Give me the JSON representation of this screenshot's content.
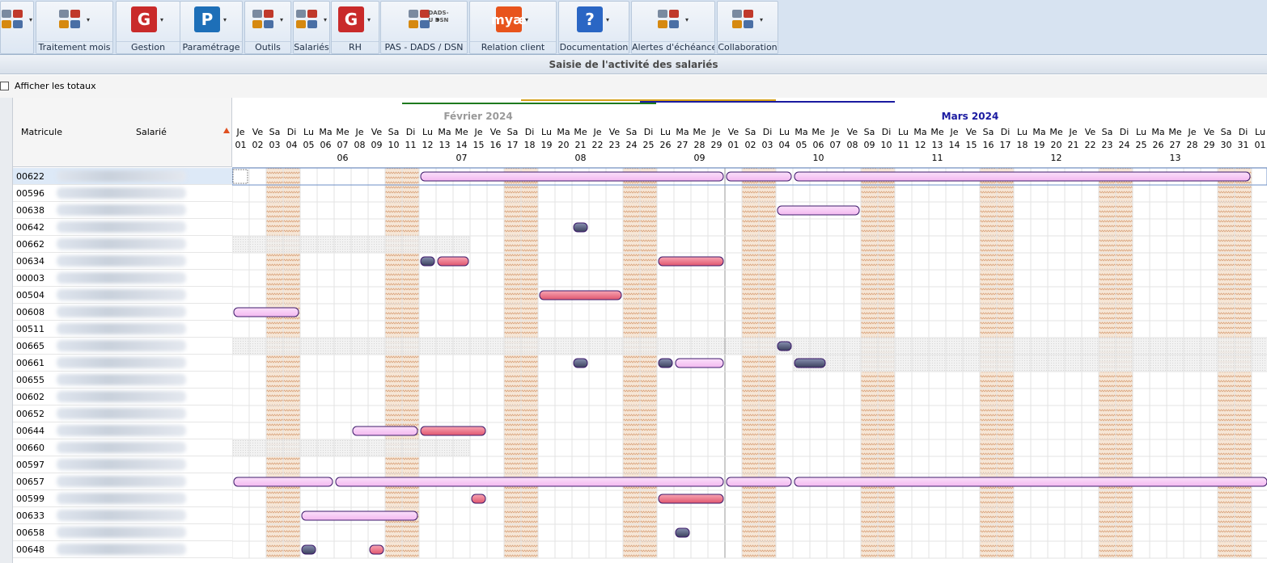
{
  "ribbon": {
    "groups": [
      {
        "id": "quick",
        "label": "",
        "icon": "quick-access-icons"
      },
      {
        "id": "traitement",
        "label": "Traitement mois",
        "icon": "monthly-processing-icons"
      },
      {
        "id": "gestion",
        "label": "Gestion",
        "icon": "gestion-g-icon",
        "glyph": "G"
      },
      {
        "id": "parametrage",
        "label": "Paramétrage",
        "icon": "parametrage-p-icon",
        "glyph": "P"
      },
      {
        "id": "outils",
        "label": "Outils",
        "icon": "tools-icon"
      },
      {
        "id": "salaries",
        "label": "Salariés",
        "icon": "employees-icon"
      },
      {
        "id": "rh",
        "label": "RH",
        "icon": "hr-icon",
        "glyph": "G"
      },
      {
        "id": "pas",
        "label": "PAS - DADS / DSN",
        "icon": "bank-building-icon",
        "sub": "DADS-U DSN"
      },
      {
        "id": "relation",
        "label": "Relation client",
        "icon": "customer-relation-icon",
        "glyph": "æ",
        "glyph_prefix": "my"
      },
      {
        "id": "documentation",
        "label": "Documentation",
        "icon": "help-book-icon",
        "glyph": "?"
      },
      {
        "id": "alertes",
        "label": "Alertes d'échéance",
        "icon": "stopwatch-icon"
      },
      {
        "id": "collaboration",
        "label": "Collaboration",
        "icon": "collaboration-icon"
      }
    ]
  },
  "page_title": "Saisie de l'activité des salariés",
  "options": {
    "show_totals_label": "Afficher les totaux",
    "show_totals_checked": false
  },
  "columns": {
    "matricule": "Matricule",
    "salarie": "Salarié"
  },
  "months": [
    {
      "label": "Février 2024",
      "color": "#9a9a9a"
    },
    {
      "label": "Mars 2024",
      "color": "#1a1aa0"
    }
  ],
  "days": [
    [
      "Je",
      "01"
    ],
    [
      "Ve",
      "02"
    ],
    [
      "Sa",
      "03"
    ],
    [
      "Di",
      "04"
    ],
    [
      "Lu",
      "05"
    ],
    [
      "Ma",
      "06"
    ],
    [
      "Me",
      "07"
    ],
    [
      "Je",
      "08"
    ],
    [
      "Ve",
      "09"
    ],
    [
      "Sa",
      "10"
    ],
    [
      "Di",
      "11"
    ],
    [
      "Lu",
      "12"
    ],
    [
      "Ma",
      "13"
    ],
    [
      "Me",
      "14"
    ],
    [
      "Je",
      "15"
    ],
    [
      "Ve",
      "16"
    ],
    [
      "Sa",
      "17"
    ],
    [
      "Di",
      "18"
    ],
    [
      "Lu",
      "19"
    ],
    [
      "Ma",
      "20"
    ],
    [
      "Me",
      "21"
    ],
    [
      "Je",
      "22"
    ],
    [
      "Ve",
      "23"
    ],
    [
      "Sa",
      "24"
    ],
    [
      "Di",
      "25"
    ],
    [
      "Lu",
      "26"
    ],
    [
      "Ma",
      "27"
    ],
    [
      "Me",
      "28"
    ],
    [
      "Je",
      "29"
    ],
    [
      "Ve",
      "01"
    ],
    [
      "Sa",
      "02"
    ],
    [
      "Di",
      "03"
    ],
    [
      "Lu",
      "04"
    ],
    [
      "Ma",
      "05"
    ],
    [
      "Me",
      "06"
    ],
    [
      "Je",
      "07"
    ],
    [
      "Ve",
      "08"
    ],
    [
      "Sa",
      "09"
    ],
    [
      "Di",
      "10"
    ],
    [
      "Lu",
      "11"
    ],
    [
      "Ma",
      "12"
    ],
    [
      "Me",
      "13"
    ],
    [
      "Je",
      "14"
    ],
    [
      "Ve",
      "15"
    ],
    [
      "Sa",
      "16"
    ],
    [
      "Di",
      "17"
    ],
    [
      "Lu",
      "18"
    ],
    [
      "Ma",
      "19"
    ],
    [
      "Me",
      "20"
    ],
    [
      "Je",
      "21"
    ],
    [
      "Ve",
      "22"
    ],
    [
      "Sa",
      "23"
    ],
    [
      "Di",
      "24"
    ],
    [
      "Lu",
      "25"
    ],
    [
      "Ma",
      "26"
    ],
    [
      "Me",
      "27"
    ],
    [
      "Je",
      "28"
    ],
    [
      "Ve",
      "29"
    ],
    [
      "Sa",
      "30"
    ],
    [
      "Di",
      "31"
    ],
    [
      "Lu",
      "01"
    ]
  ],
  "weeks": [
    {
      "label": "06",
      "start": 4
    },
    {
      "label": "07",
      "start": 11
    },
    {
      "label": "08",
      "start": 18
    },
    {
      "label": "09",
      "start": 25
    },
    {
      "label": "10",
      "start": 32
    },
    {
      "label": "11",
      "start": 39
    },
    {
      "label": "12",
      "start": 46
    },
    {
      "label": "13",
      "start": 53
    }
  ],
  "employees": [
    {
      "matricule": "00622",
      "selected": true
    },
    {
      "matricule": "00596"
    },
    {
      "matricule": "00638"
    },
    {
      "matricule": "00642"
    },
    {
      "matricule": "00662",
      "inactive": [
        0,
        13
      ]
    },
    {
      "matricule": "00634"
    },
    {
      "matricule": "00003"
    },
    {
      "matricule": "00504"
    },
    {
      "matricule": "00608"
    },
    {
      "matricule": "00511"
    },
    {
      "matricule": "00665",
      "inactive": [
        0,
        60
      ]
    },
    {
      "matricule": "00661",
      "inactive": [
        33,
        60
      ]
    },
    {
      "matricule": "00655"
    },
    {
      "matricule": "00602"
    },
    {
      "matricule": "00652"
    },
    {
      "matricule": "00644"
    },
    {
      "matricule": "00660",
      "inactive": [
        0,
        13
      ]
    },
    {
      "matricule": "00597"
    },
    {
      "matricule": "00657"
    },
    {
      "matricule": "00599"
    },
    {
      "matricule": "00633"
    },
    {
      "matricule": "00658"
    },
    {
      "matricule": "00648"
    }
  ],
  "activities": [
    {
      "row": 0,
      "start": 11,
      "end": 28,
      "type": "pink"
    },
    {
      "row": 0,
      "start": 29,
      "end": 32,
      "type": "pink"
    },
    {
      "row": 0,
      "start": 33,
      "end": 59,
      "type": "pink"
    },
    {
      "row": 2,
      "start": 32,
      "end": 36,
      "type": "pink"
    },
    {
      "row": 3,
      "start": 20,
      "end": 20,
      "type": "navy"
    },
    {
      "row": 5,
      "start": 11,
      "end": 11,
      "type": "navy"
    },
    {
      "row": 5,
      "start": 12,
      "end": 13,
      "type": "red"
    },
    {
      "row": 5,
      "start": 25,
      "end": 28,
      "type": "red"
    },
    {
      "row": 7,
      "start": 18,
      "end": 22,
      "type": "red"
    },
    {
      "row": 8,
      "start": 0,
      "end": 3,
      "type": "pink"
    },
    {
      "row": 10,
      "start": 32,
      "end": 32,
      "type": "navy"
    },
    {
      "row": 11,
      "start": 20,
      "end": 20,
      "type": "navy"
    },
    {
      "row": 11,
      "start": 25,
      "end": 25,
      "type": "navy"
    },
    {
      "row": 11,
      "start": 26,
      "end": 28,
      "type": "pink"
    },
    {
      "row": 11,
      "start": 33,
      "end": 34,
      "type": "navy"
    },
    {
      "row": 15,
      "start": 7,
      "end": 10,
      "type": "pink"
    },
    {
      "row": 15,
      "start": 11,
      "end": 14,
      "type": "red"
    },
    {
      "row": 18,
      "start": 0,
      "end": 5,
      "type": "pink"
    },
    {
      "row": 18,
      "start": 6,
      "end": 28,
      "type": "pink"
    },
    {
      "row": 18,
      "start": 29,
      "end": 32,
      "type": "pink"
    },
    {
      "row": 18,
      "start": 33,
      "end": 60,
      "type": "pink"
    },
    {
      "row": 19,
      "start": 14,
      "end": 14,
      "type": "red"
    },
    {
      "row": 19,
      "start": 25,
      "end": 28,
      "type": "red"
    },
    {
      "row": 20,
      "start": 4,
      "end": 10,
      "type": "pink"
    },
    {
      "row": 21,
      "start": 26,
      "end": 26,
      "type": "navy"
    },
    {
      "row": 22,
      "start": 4,
      "end": 4,
      "type": "navy"
    },
    {
      "row": 22,
      "start": 8,
      "end": 8,
      "type": "red"
    }
  ],
  "colors": {
    "ribbon_bg": "#d7e3f1",
    "accent_navy": "#1a1aa0",
    "accent_gold": "#d4a017",
    "accent_green": "#1e7a1e",
    "activity_pink": "#f3b8f0",
    "activity_red": "#e0566e",
    "activity_navy": "#3a3f5c",
    "weekend": "#f6e6d6"
  }
}
